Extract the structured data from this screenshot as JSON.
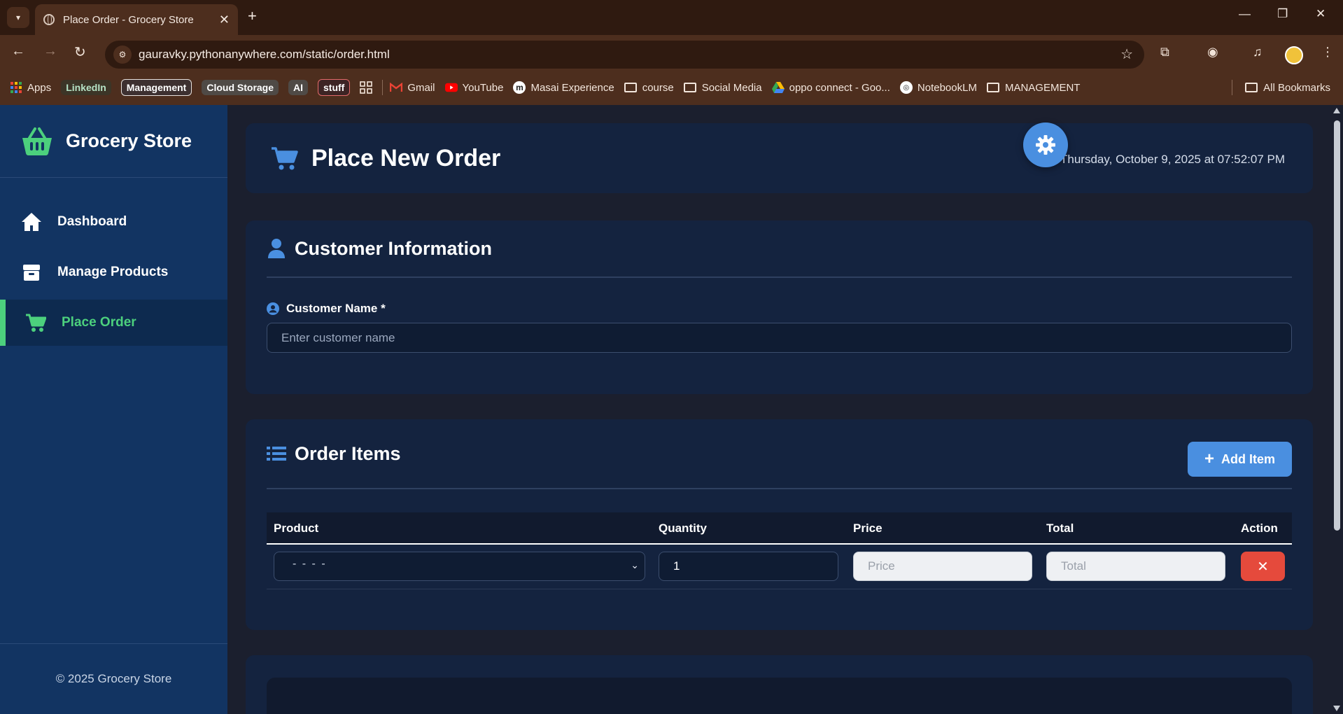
{
  "browser": {
    "tab_title": "Place Order - Grocery Store",
    "url": "gauravky.pythonanywhere.com/static/order.html",
    "bookmarks": [
      {
        "label": "Apps",
        "kind": "apps"
      },
      {
        "label": "LinkedIn",
        "kind": "chip-linkedin"
      },
      {
        "label": "Management",
        "kind": "chip-mgmt"
      },
      {
        "label": "Cloud Storage",
        "kind": "chip-cloud"
      },
      {
        "label": "AI",
        "kind": "chip-ai"
      },
      {
        "label": "stuff",
        "kind": "chip-stuff"
      },
      {
        "label": "Gmail",
        "kind": "gmail"
      },
      {
        "label": "YouTube",
        "kind": "youtube"
      },
      {
        "label": "Masai Experience",
        "kind": "masai"
      },
      {
        "label": "course",
        "kind": "folder"
      },
      {
        "label": "Social Media",
        "kind": "folder"
      },
      {
        "label": "oppo connect - Goo...",
        "kind": "drive"
      },
      {
        "label": "NotebookLM",
        "kind": "notebook"
      },
      {
        "label": "MANAGEMENT",
        "kind": "folder"
      }
    ],
    "all_bookmarks": "All Bookmarks"
  },
  "sidebar": {
    "brand": "Grocery Store",
    "items": [
      {
        "label": "Dashboard",
        "icon": "home-icon"
      },
      {
        "label": "Manage Products",
        "icon": "box-icon"
      },
      {
        "label": "Place Order",
        "icon": "cart-icon",
        "active": true
      }
    ],
    "footer": "© 2025 Grocery Store"
  },
  "header": {
    "title": "Place New Order",
    "datetime": "Thursday, October 9, 2025 at 07:52:07 PM"
  },
  "customer": {
    "section_title": "Customer Information",
    "name_label": "Customer Name *",
    "name_placeholder": "Enter customer name",
    "name_value": ""
  },
  "order_items": {
    "section_title": "Order Items",
    "add_button": "Add Item",
    "columns": [
      "Product",
      "Quantity",
      "Price",
      "Total",
      "Action"
    ],
    "rows": [
      {
        "product": "- -  -  -",
        "quantity": "1",
        "price_placeholder": "Price",
        "total_placeholder": "Total",
        "action": "✕"
      }
    ]
  },
  "colors": {
    "accent_blue": "#4a8fe0",
    "active_green": "#4cd07d",
    "danger_red": "#e54a3c",
    "sidebar_bg": "#123462"
  }
}
